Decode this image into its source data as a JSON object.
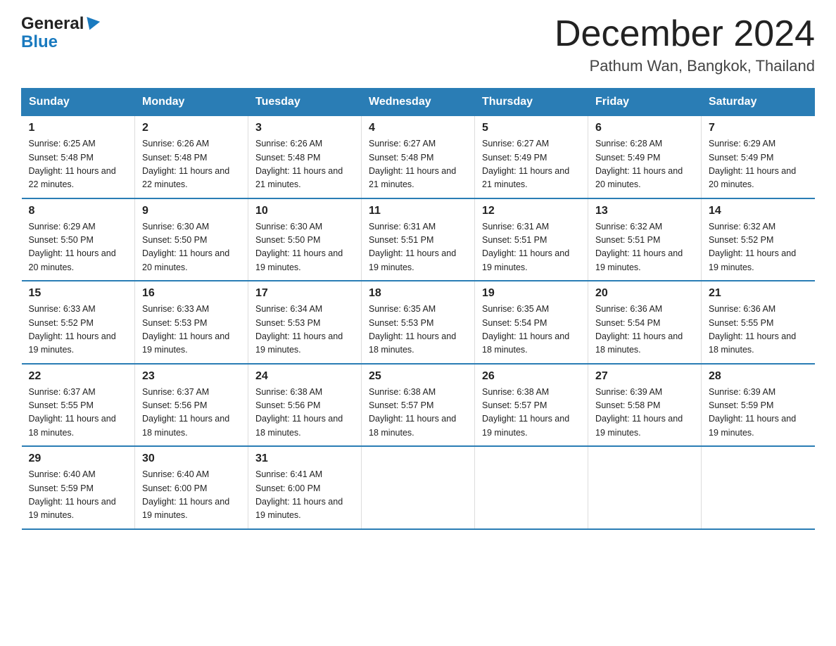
{
  "header": {
    "logo_general": "General",
    "logo_blue": "Blue",
    "month_title": "December 2024",
    "location": "Pathum Wan, Bangkok, Thailand"
  },
  "weekdays": [
    "Sunday",
    "Monday",
    "Tuesday",
    "Wednesday",
    "Thursday",
    "Friday",
    "Saturday"
  ],
  "weeks": [
    [
      {
        "day": "1",
        "sunrise": "6:25 AM",
        "sunset": "5:48 PM",
        "daylight": "11 hours and 22 minutes."
      },
      {
        "day": "2",
        "sunrise": "6:26 AM",
        "sunset": "5:48 PM",
        "daylight": "11 hours and 22 minutes."
      },
      {
        "day": "3",
        "sunrise": "6:26 AM",
        "sunset": "5:48 PM",
        "daylight": "11 hours and 21 minutes."
      },
      {
        "day": "4",
        "sunrise": "6:27 AM",
        "sunset": "5:48 PM",
        "daylight": "11 hours and 21 minutes."
      },
      {
        "day": "5",
        "sunrise": "6:27 AM",
        "sunset": "5:49 PM",
        "daylight": "11 hours and 21 minutes."
      },
      {
        "day": "6",
        "sunrise": "6:28 AM",
        "sunset": "5:49 PM",
        "daylight": "11 hours and 20 minutes."
      },
      {
        "day": "7",
        "sunrise": "6:29 AM",
        "sunset": "5:49 PM",
        "daylight": "11 hours and 20 minutes."
      }
    ],
    [
      {
        "day": "8",
        "sunrise": "6:29 AM",
        "sunset": "5:50 PM",
        "daylight": "11 hours and 20 minutes."
      },
      {
        "day": "9",
        "sunrise": "6:30 AM",
        "sunset": "5:50 PM",
        "daylight": "11 hours and 20 minutes."
      },
      {
        "day": "10",
        "sunrise": "6:30 AM",
        "sunset": "5:50 PM",
        "daylight": "11 hours and 19 minutes."
      },
      {
        "day": "11",
        "sunrise": "6:31 AM",
        "sunset": "5:51 PM",
        "daylight": "11 hours and 19 minutes."
      },
      {
        "day": "12",
        "sunrise": "6:31 AM",
        "sunset": "5:51 PM",
        "daylight": "11 hours and 19 minutes."
      },
      {
        "day": "13",
        "sunrise": "6:32 AM",
        "sunset": "5:51 PM",
        "daylight": "11 hours and 19 minutes."
      },
      {
        "day": "14",
        "sunrise": "6:32 AM",
        "sunset": "5:52 PM",
        "daylight": "11 hours and 19 minutes."
      }
    ],
    [
      {
        "day": "15",
        "sunrise": "6:33 AM",
        "sunset": "5:52 PM",
        "daylight": "11 hours and 19 minutes."
      },
      {
        "day": "16",
        "sunrise": "6:33 AM",
        "sunset": "5:53 PM",
        "daylight": "11 hours and 19 minutes."
      },
      {
        "day": "17",
        "sunrise": "6:34 AM",
        "sunset": "5:53 PM",
        "daylight": "11 hours and 19 minutes."
      },
      {
        "day": "18",
        "sunrise": "6:35 AM",
        "sunset": "5:53 PM",
        "daylight": "11 hours and 18 minutes."
      },
      {
        "day": "19",
        "sunrise": "6:35 AM",
        "sunset": "5:54 PM",
        "daylight": "11 hours and 18 minutes."
      },
      {
        "day": "20",
        "sunrise": "6:36 AM",
        "sunset": "5:54 PM",
        "daylight": "11 hours and 18 minutes."
      },
      {
        "day": "21",
        "sunrise": "6:36 AM",
        "sunset": "5:55 PM",
        "daylight": "11 hours and 18 minutes."
      }
    ],
    [
      {
        "day": "22",
        "sunrise": "6:37 AM",
        "sunset": "5:55 PM",
        "daylight": "11 hours and 18 minutes."
      },
      {
        "day": "23",
        "sunrise": "6:37 AM",
        "sunset": "5:56 PM",
        "daylight": "11 hours and 18 minutes."
      },
      {
        "day": "24",
        "sunrise": "6:38 AM",
        "sunset": "5:56 PM",
        "daylight": "11 hours and 18 minutes."
      },
      {
        "day": "25",
        "sunrise": "6:38 AM",
        "sunset": "5:57 PM",
        "daylight": "11 hours and 18 minutes."
      },
      {
        "day": "26",
        "sunrise": "6:38 AM",
        "sunset": "5:57 PM",
        "daylight": "11 hours and 19 minutes."
      },
      {
        "day": "27",
        "sunrise": "6:39 AM",
        "sunset": "5:58 PM",
        "daylight": "11 hours and 19 minutes."
      },
      {
        "day": "28",
        "sunrise": "6:39 AM",
        "sunset": "5:59 PM",
        "daylight": "11 hours and 19 minutes."
      }
    ],
    [
      {
        "day": "29",
        "sunrise": "6:40 AM",
        "sunset": "5:59 PM",
        "daylight": "11 hours and 19 minutes."
      },
      {
        "day": "30",
        "sunrise": "6:40 AM",
        "sunset": "6:00 PM",
        "daylight": "11 hours and 19 minutes."
      },
      {
        "day": "31",
        "sunrise": "6:41 AM",
        "sunset": "6:00 PM",
        "daylight": "11 hours and 19 minutes."
      },
      null,
      null,
      null,
      null
    ]
  ]
}
